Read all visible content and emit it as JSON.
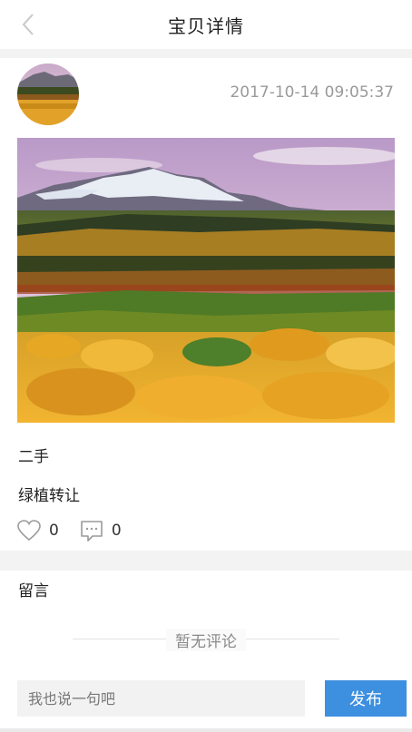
{
  "header": {
    "title": "宝贝详情",
    "back_icon": "chevron-left-icon"
  },
  "post": {
    "timestamp": "2017-10-14 09:05:37",
    "category": "二手",
    "title": "绿植转让",
    "likes": "0",
    "comments": "0"
  },
  "comments_section": {
    "label": "留言",
    "empty_text": "暂无评论"
  },
  "composer": {
    "placeholder": "我也说一句吧",
    "submit_label": "发布"
  },
  "colors": {
    "accent": "#3d8fe0",
    "timestamp_gray": "#9a9a9a",
    "band_gray": "#f3f3f3"
  }
}
